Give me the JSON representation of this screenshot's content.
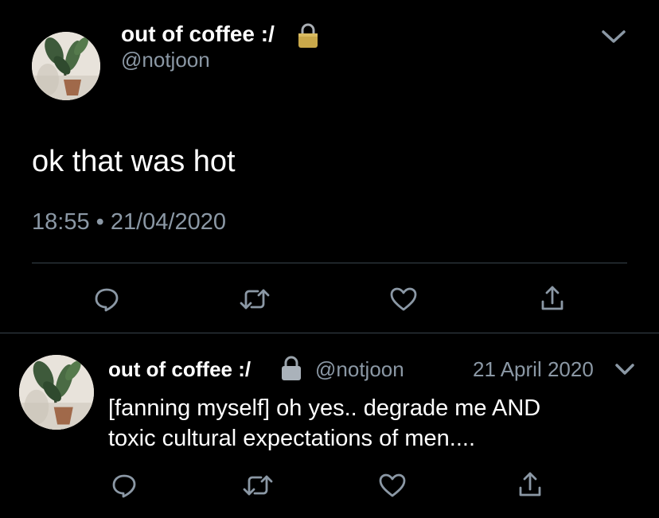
{
  "main_tweet": {
    "display_name": "out of coffee :/",
    "handle": "@notjoon",
    "protected_icon": "lock-icon",
    "menu_icon": "chevron-down-icon",
    "text": "ok that was hot",
    "time": "18:55",
    "separator": "•",
    "date": "21/04/2020",
    "actions": [
      "reply-icon",
      "retweet-icon",
      "like-icon",
      "share-icon"
    ]
  },
  "reply_tweet": {
    "display_name": "out of coffee :/",
    "handle": "@notjoon",
    "protected_icon": "lock-icon",
    "date": "21 April 2020",
    "menu_icon": "chevron-down-icon",
    "text_line1": "[fanning myself] oh yes.. degrade me AND",
    "text_line2": "toxic cultural expectations of men....",
    "actions": [
      "reply-icon",
      "retweet-icon",
      "like-icon",
      "share-icon"
    ]
  },
  "colors": {
    "background": "#000000",
    "text": "#ffffff",
    "secondary": "#8b98a5",
    "divider": "#38444d",
    "lock_gold": "#c9a84a"
  }
}
